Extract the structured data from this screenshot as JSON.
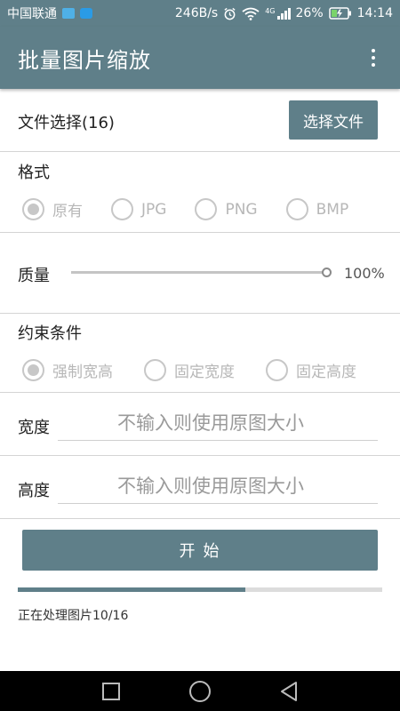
{
  "status_bar": {
    "carrier": "中国联通",
    "speed": "246B/s",
    "signal_type": "4G",
    "battery": "26%",
    "time": "14:14"
  },
  "app_bar": {
    "title": "批量图片缩放",
    "overflow_icon": "more-vert-icon"
  },
  "file_select": {
    "label": "文件选择(16)",
    "button_label": "选择文件"
  },
  "format": {
    "label": "格式",
    "options": [
      "原有",
      "JPG",
      "PNG",
      "BMP"
    ],
    "selected": "原有"
  },
  "quality": {
    "label": "质量",
    "value_text": "100%",
    "value": 100
  },
  "constraint": {
    "label": "约束条件",
    "options": [
      "强制宽高",
      "固定宽度",
      "固定高度"
    ],
    "selected": "强制宽高"
  },
  "width": {
    "label": "宽度",
    "placeholder": "不输入则使用原图大小",
    "value": ""
  },
  "height": {
    "label": "高度",
    "placeholder": "不输入则使用原图大小",
    "value": ""
  },
  "start_button": {
    "label": "开 始"
  },
  "progress": {
    "fraction": 0.625,
    "status_text": "正在处理图片10/16"
  },
  "colors": {
    "accent": "#5f7f89",
    "disabled": "#c7c7c7"
  },
  "nav_bar": {
    "icons": [
      "recents-square-icon",
      "home-circle-icon",
      "back-triangle-icon"
    ]
  }
}
